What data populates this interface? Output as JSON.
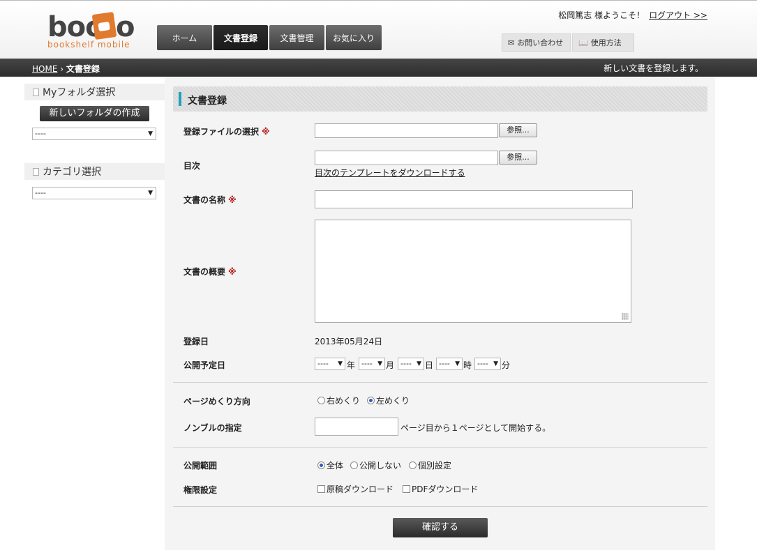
{
  "header": {
    "logo_main": "boo",
    "logo_end": "o",
    "logo_sub": "bookshelf mobile",
    "nav": [
      {
        "label": "ホーム"
      },
      {
        "label": "文書登録"
      },
      {
        "label": "文書管理"
      },
      {
        "label": "お気に入り"
      }
    ],
    "welcome": "松岡篤志 様ようこそ！",
    "logout": "ログアウト >>",
    "contact": "お問い合わせ",
    "howto": "使用方法"
  },
  "breadcrumb": {
    "home": "HOME",
    "sep": "›",
    "current": "文書登録",
    "note": "新しい文書を登録します。"
  },
  "sidebar": {
    "folder_title": "Myフォルダ選択",
    "new_folder_button": "新しいフォルダの作成",
    "folder_select": "----",
    "category_title": "カテゴリ選択",
    "category_select": "----"
  },
  "form": {
    "title": "文書登録",
    "required_mark": "※",
    "file_label": "登録ファイルの選択",
    "browse": "参照...",
    "toc_label": "目次",
    "toc_template_link": "目次のテンプレートをダウンロードする",
    "name_label": "文書の名称",
    "summary_label": "文書の概要",
    "regdate_label": "登録日",
    "regdate_value": "2013年05月24日",
    "pubdate_label": "公開予定日",
    "pubdate": {
      "year": "----",
      "year_unit": "年",
      "month": "----",
      "month_unit": "月",
      "day": "----",
      "day_unit": "日",
      "hour": "----",
      "hour_unit": "時",
      "minute": "----",
      "minute_unit": "分"
    },
    "page_dir_label": "ページめくり方向",
    "page_dir_right": "右めくり",
    "page_dir_left": "左めくり",
    "page_dir_selected": "left",
    "nombre_label": "ノンブルの指定",
    "nombre_value": "",
    "nombre_suffix": "ページ目から１ページとして開始する。",
    "scope_label": "公開範囲",
    "scope_all": "全体",
    "scope_private": "公開しない",
    "scope_individual": "個別設定",
    "scope_selected": "all",
    "perm_label": "権限設定",
    "perm_original": "原稿ダウンロード",
    "perm_pdf": "PDFダウンロード",
    "submit": "確認する"
  }
}
